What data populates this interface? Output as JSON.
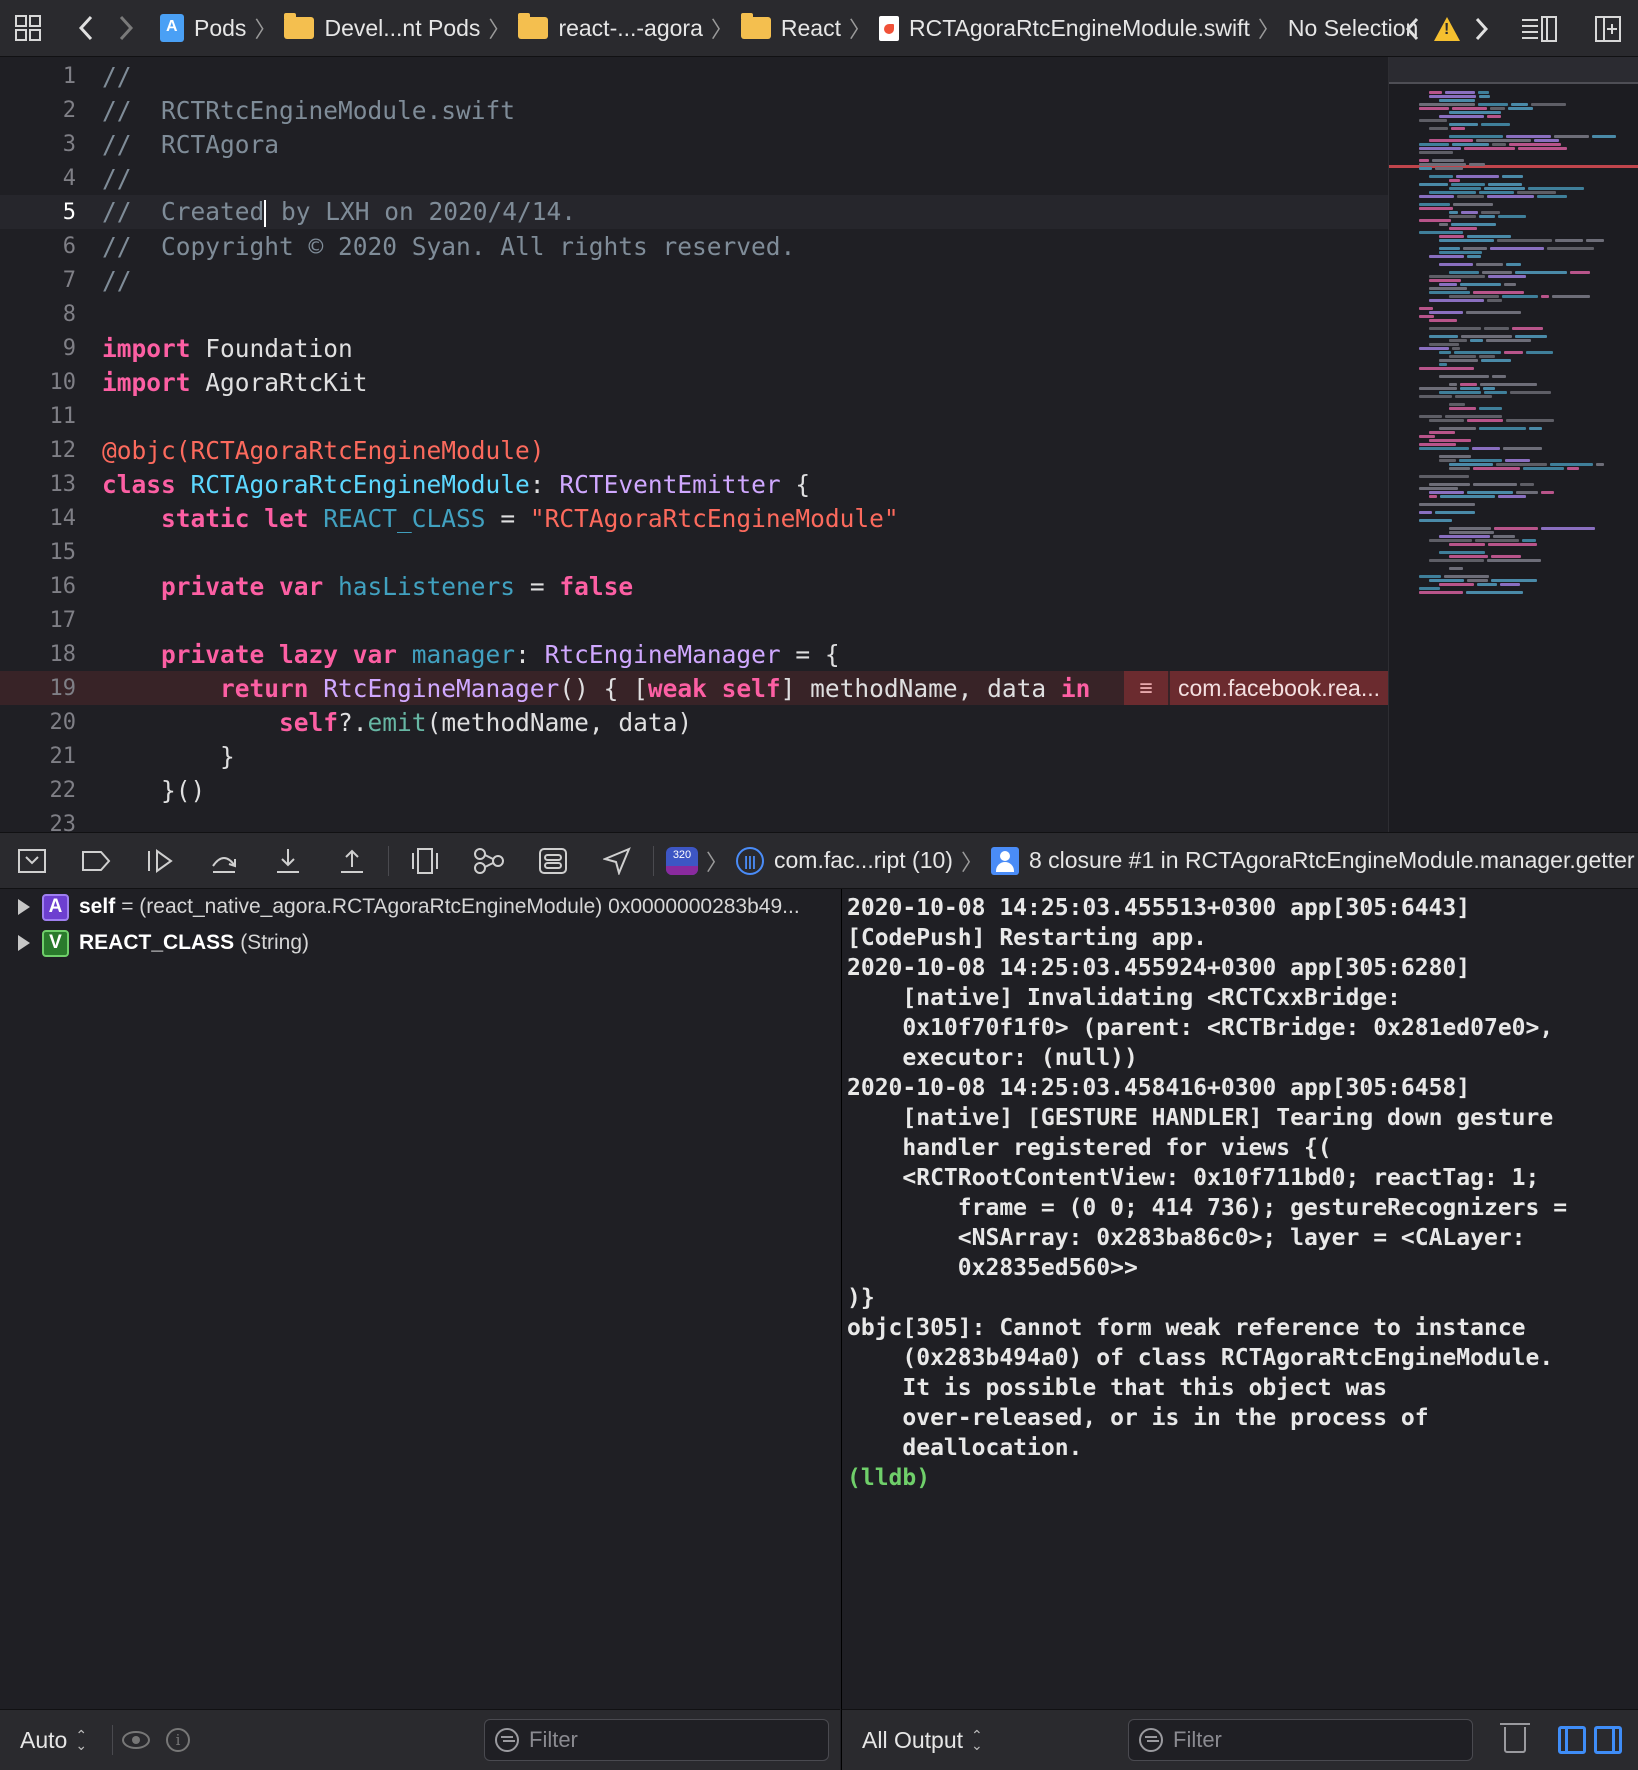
{
  "jumpbar": {
    "crumbs": [
      "Pods",
      "Devel...nt Pods",
      "react-...-agora",
      "React",
      "RCTAgoraRtcEngineModule.swift",
      "No Selection"
    ]
  },
  "editor": {
    "error_message": "com.facebook.rea..."
  },
  "debugbar": {
    "thread_badge": "320",
    "queue_label": "com.fac...ript (10)",
    "frame_label": "8 closure #1 in RCTAgoraRtcEngineModule.manager.getter"
  },
  "variables": [
    {
      "badge": "A",
      "name": "self",
      "rest": "= (react_native_agora.RCTAgoraRtcEngineModule) 0x0000000283b49..."
    },
    {
      "badge": "V",
      "name": "REACT_CLASS",
      "rest": "(String)"
    }
  ],
  "console": {
    "output": "2020-10-08 14:25:03.455513+0300 app[305:6443]\n[CodePush] Restarting app.\n2020-10-08 14:25:03.455924+0300 app[305:6280]\n    [native] Invalidating <RCTCxxBridge:\n    0x10f70f1f0> (parent: <RCTBridge: 0x281ed07e0>,\n    executor: (null))\n2020-10-08 14:25:03.458416+0300 app[305:6458]\n    [native] [GESTURE HANDLER] Tearing down gesture\n    handler registered for views {(\n    <RCTRootContentView: 0x10f711bd0; reactTag: 1;\n        frame = (0 0; 414 736); gestureRecognizers =\n        <NSArray: 0x283ba86c0>; layer = <CALayer:\n        0x2835ed560>>\n)}\nobjc[305]: Cannot form weak reference to instance\n    (0x283b494a0) of class RCTAgoraRtcEngineModule.\n    It is possible that this object was\n    over-released, or is in the process of\n    deallocation.",
    "prompt": "(lldb)"
  },
  "bottom": {
    "variables_scope": "Auto",
    "variables_filter_placeholder": "Filter",
    "console_scope": "All Output",
    "console_filter_placeholder": "Filter"
  }
}
